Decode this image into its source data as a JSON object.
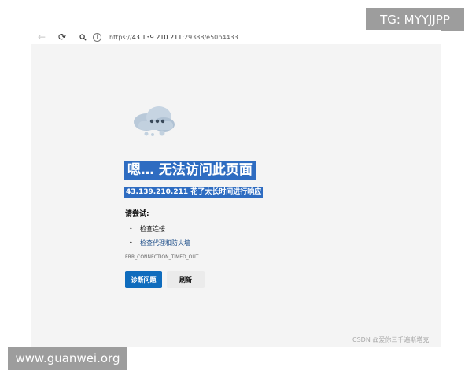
{
  "watermarks": {
    "top_right": "TG: MYYJJPP",
    "bottom_left": "www.guanwei.org",
    "csdn": "CSDN @爱你三千遍斯塔克"
  },
  "browser": {
    "url_prefix": "https://",
    "url_host": "43.139.210.211",
    "url_rest": ":29388/e50b4433"
  },
  "error_page": {
    "title": "嗯… 无法访问此页面",
    "subtitle": "43.139.210.211 花了太长时间进行响应",
    "try_label": "请尝试:",
    "suggestions": [
      "检查连接",
      "检查代理和防火墙"
    ],
    "error_code": "ERR_CONNECTION_TIMED_OUT",
    "diagnose_button": "诊断问题",
    "refresh_button": "刷新"
  },
  "colors": {
    "accent": "#0f6cbd",
    "highlight": "#2e6cc1",
    "page_bg": "#f4f4f4"
  }
}
